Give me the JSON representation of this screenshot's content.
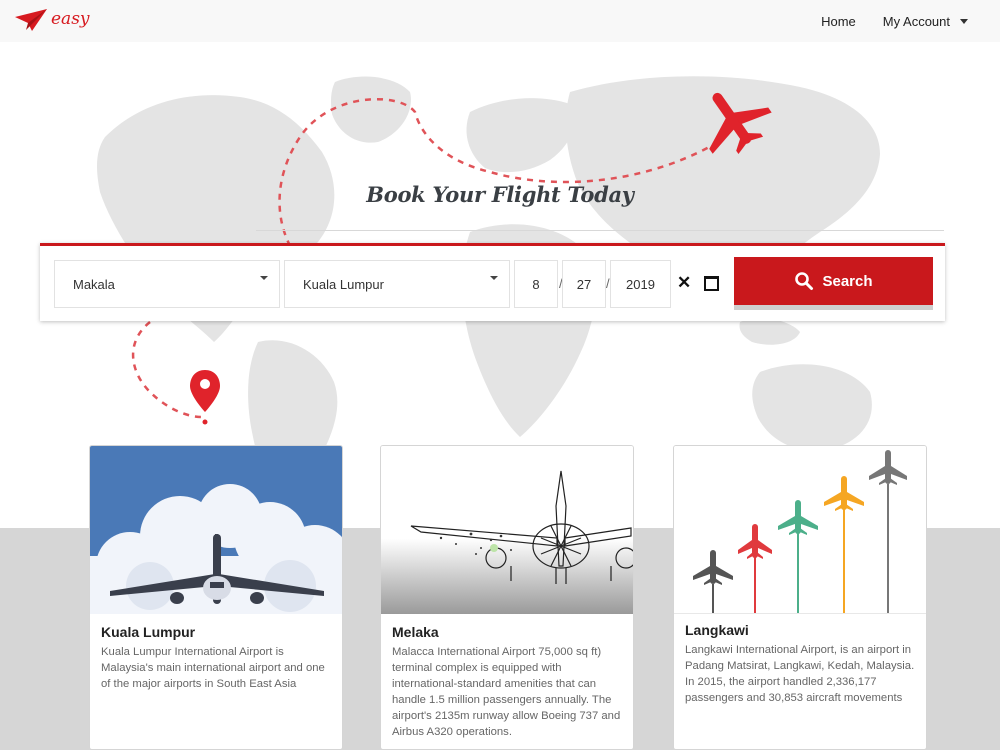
{
  "brand": {
    "name": "easy",
    "color": "#d71a20",
    "icon": "paper-plane-icon"
  },
  "nav": {
    "home": "Home",
    "account": "My Account"
  },
  "hero": {
    "title": "Book Your Flight Today"
  },
  "search": {
    "from": "Makala",
    "to": "Kuala Lumpur",
    "month": "8",
    "day": "27",
    "year": "2019",
    "sep1": "/",
    "sep2": "/",
    "clear": "✕",
    "button": "Search",
    "accent": "#c9181c"
  },
  "cards": [
    {
      "title": "Kuala Lumpur",
      "text": "Kuala Lumpur International Airport is Malaysia's main international airport and one of the major airports in South East Asia"
    },
    {
      "title": "Melaka",
      "text": "Malacca International Airport 75,000 sq ft) terminal complex is equipped with international-standard amenities that can handle 1.5 million passengers annually. The airport's 2135m runway allow Boeing 737 and Airbus A320 operations."
    },
    {
      "title": "Langkawi",
      "text": "Langkawi International Airport, is an airport in Padang Matsirat, Langkawi, Kedah, Malaysia. In 2015, the airport handled 2,336,177 passengers and 30,853 aircraft movements"
    }
  ]
}
